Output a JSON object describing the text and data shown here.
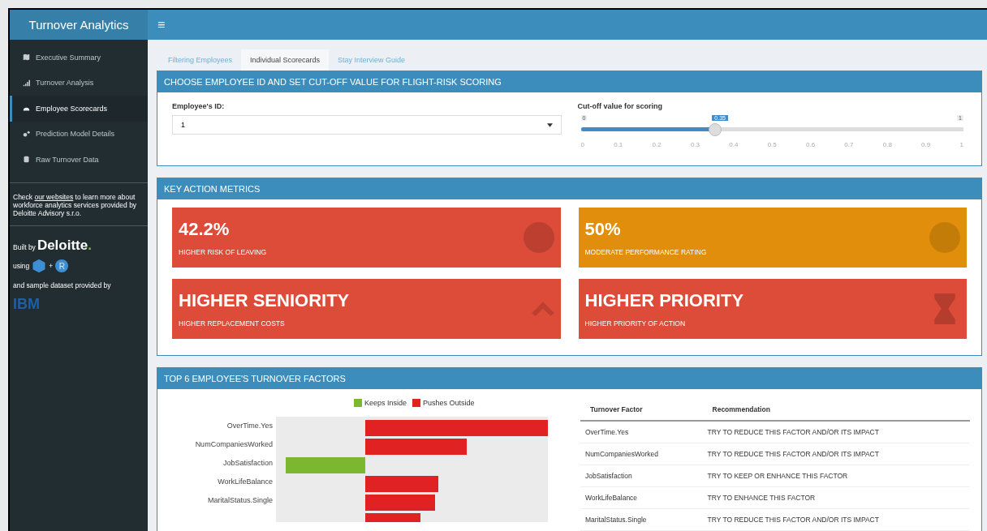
{
  "app": {
    "title": "Turnover Analytics",
    "menu_icon": "≡"
  },
  "sidebar": {
    "items": [
      {
        "label": "Executive Summary",
        "selected": false
      },
      {
        "label": "Turnover Analysis",
        "selected": false
      },
      {
        "label": "Employee Scorecards",
        "selected": true
      },
      {
        "label": "Prediction Model Details",
        "selected": false
      },
      {
        "label": "Raw Turnover Data",
        "selected": false
      }
    ],
    "info_before": "Check ",
    "info_link": "our websites",
    "info_after": " to learn more about workforce analytics services provided by Deloitte Advisory s.r.o.",
    "built_by": "Built by",
    "brand": "Deloitte",
    "brand_dot": ".",
    "using": "using",
    "plus": "+",
    "r_logo": "R",
    "dataset": "and sample dataset provided by",
    "ibm": "IBM"
  },
  "tabs": [
    {
      "label": "Filtering Employees",
      "selected": false
    },
    {
      "label": "Individual Scorecards",
      "selected": true
    },
    {
      "label": "Stay Interview Guide",
      "selected": false
    }
  ],
  "controls": {
    "title": "CHOOSE EMPLOYEE ID AND SET CUT-OFF VALUE FOR FLIGHT-RISK SCORING",
    "id_label": "Employee's ID:",
    "id_value": "1",
    "slider_label": "Cut-off value for scoring",
    "min": "0",
    "max": "1",
    "value": "0.35",
    "level": 0.35,
    "ticks": [
      "0",
      "0.1",
      "0.2",
      "0.3",
      "0.4",
      "0.5",
      "0.6",
      "0.7",
      "0.8",
      "0.9",
      "1"
    ]
  },
  "metrics": {
    "title": "KEY ACTION METRICS",
    "boxes": [
      {
        "value": "42.2%",
        "caption": "HIGHER RISK OF LEAVING",
        "color": "#dd4b39"
      },
      {
        "value": "50%",
        "caption": "MODERATE PERFORMANCE RATING",
        "color": "#e08e0b"
      },
      {
        "value": "HIGHER SENIORITY",
        "caption": "HIGHER REPLACEMENT COSTS",
        "color": "#dd4b39"
      },
      {
        "value": "HIGHER PRIORITY",
        "caption": "HIGHER PRIORITY OF ACTION",
        "color": "#dd4b39"
      }
    ]
  },
  "factors": {
    "title": "TOP 6 EMPLOYEE'S TURNOVER FACTORS",
    "legend": [
      {
        "label": "Keeps Inside",
        "color": "#7cb82f"
      },
      {
        "label": "Pushes Outside",
        "color": "#e02222"
      }
    ],
    "chart_labels": [
      {
        "label": "OverTime.Yes",
        "kind": "pushes"
      },
      {
        "label": "NumCompaniesWorked",
        "kind": "pushes"
      },
      {
        "label": "JobSatisfaction",
        "kind": "keeps"
      },
      {
        "label": "WorkLifeBalance",
        "kind": "pushes"
      },
      {
        "label": "MaritalStatus.Single",
        "kind": "pushes"
      }
    ],
    "columns": [
      "Turnover Factor",
      "Recommendation"
    ],
    "rows": [
      [
        "OverTime.Yes",
        "TRY TO REDUCE THIS FACTOR AND/OR ITS IMPACT"
      ],
      [
        "NumCompaniesWorked",
        "TRY TO REDUCE THIS FACTOR AND/OR ITS IMPACT"
      ],
      [
        "JobSatisfaction",
        "TRY TO KEEP OR ENHANCE THIS FACTOR"
      ],
      [
        "WorkLifeBalance",
        "TRY TO ENHANCE THIS FACTOR"
      ],
      [
        "MaritalStatus.Single",
        "TRY TO REDUCE THIS FACTOR AND/OR ITS IMPACT"
      ]
    ]
  }
}
